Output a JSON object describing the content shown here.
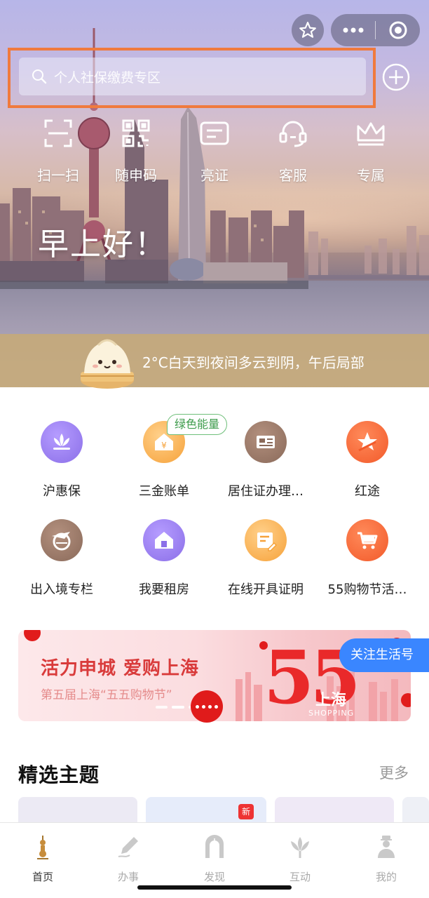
{
  "header": {
    "favorite_icon": "star-icon",
    "more_icon": "ellipsis-icon",
    "close_icon": "target-icon"
  },
  "search": {
    "placeholder": "个人社保缴费专区"
  },
  "quick_actions": [
    {
      "label": "扫一扫",
      "icon": "scan-icon"
    },
    {
      "label": "随申码",
      "icon": "qr-code-icon"
    },
    {
      "label": "亮证",
      "icon": "id-card-icon"
    },
    {
      "label": "客服",
      "icon": "headset-icon"
    },
    {
      "label": "专属",
      "icon": "crown-icon"
    }
  ],
  "greeting": "早上好！",
  "weather": {
    "text": "2°C白天到夜间多云到阴，午后局部"
  },
  "services": [
    {
      "label": "沪惠保",
      "icon": "lotus-icon",
      "color": "#8b6fe8"
    },
    {
      "label": "三金账单",
      "icon": "yen-house-icon",
      "color": "#f6a23a",
      "tag": "绿色能量"
    },
    {
      "label": "居住证办理…",
      "icon": "certificate-icon",
      "color": "#8a6a5a"
    },
    {
      "label": "红途",
      "icon": "star-flag-icon",
      "color": "#f25a2a"
    },
    {
      "label": "出入境专栏",
      "icon": "plane-globe-icon",
      "color": "#8a6a5a"
    },
    {
      "label": "我要租房",
      "icon": "house-icon",
      "color": "#8b6fe8"
    },
    {
      "label": "在线开具证明",
      "icon": "document-edit-icon",
      "color": "#f6a23a"
    },
    {
      "label": "55购物节活…",
      "icon": "cart-icon",
      "color": "#f25a2a"
    }
  ],
  "banner": {
    "title": "活力申城  爱购上海",
    "subtitle": "第五届上海“五五购物节”",
    "graphic_number": "55",
    "graphic_city": "上海",
    "graphic_sub": "SHOPPING"
  },
  "follow_button": {
    "label": "关注生活号"
  },
  "themes": {
    "title": "精选主题",
    "more": "更多",
    "new_badge": "新"
  },
  "tabs": [
    {
      "label": "首页",
      "icon": "pagoda-icon",
      "active": true
    },
    {
      "label": "办事",
      "icon": "pen-icon",
      "active": false
    },
    {
      "label": "发现",
      "icon": "arch-icon",
      "active": false
    },
    {
      "label": "互动",
      "icon": "flower-icon",
      "active": false
    },
    {
      "label": "我的",
      "icon": "person-icon",
      "active": false
    }
  ],
  "colors": {
    "highlight": "#f07a3d",
    "follow": "#3a86ff",
    "banner_red": "#e9292a",
    "weather_bar": "#c6aa78"
  }
}
